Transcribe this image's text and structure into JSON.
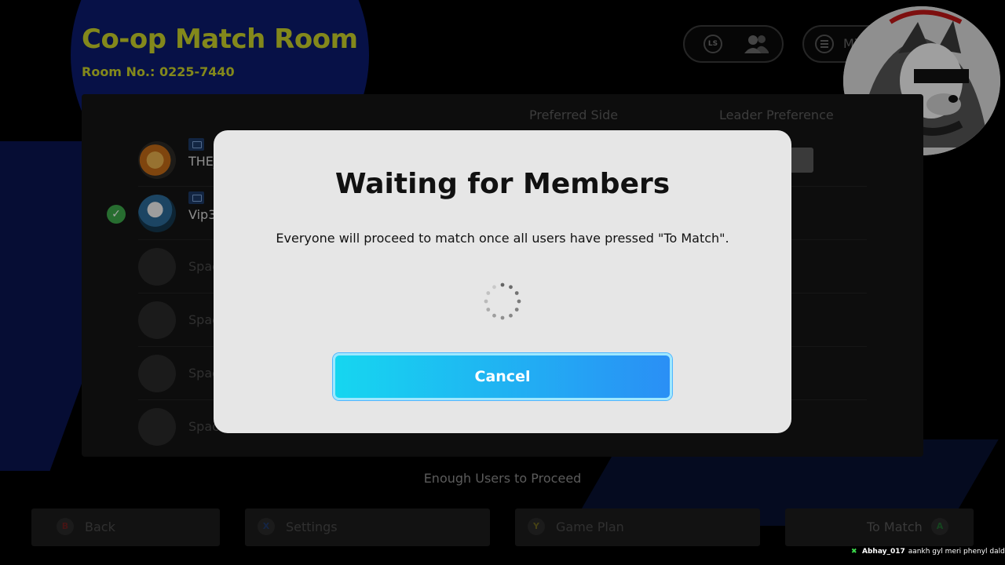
{
  "header": {
    "title": "Co-op Match Room",
    "room_no": "Room No.: 0225-7440",
    "ls_badge": "LS",
    "mission_label": "Mission"
  },
  "columns": {
    "preferred_side": "Preferred Side",
    "leader_preference": "Leader Preference"
  },
  "members": [
    {
      "name": "THE_",
      "icon": "pc-icon"
    },
    {
      "name": "Vip3",
      "icon": "pc-icon",
      "ready": true
    }
  ],
  "spaces": [
    {
      "label": "Spac"
    },
    {
      "label": "Spac"
    },
    {
      "label": "Spac"
    },
    {
      "label": "Spac"
    }
  ],
  "status": "Enough Users to Proceed",
  "bottom_bar": {
    "back": {
      "label": "Back",
      "glyph": "B"
    },
    "settings": {
      "label": "Settings",
      "glyph": "X"
    },
    "game_plan": {
      "label": "Game Plan",
      "glyph": "Y"
    },
    "to_match": {
      "label": "To Match",
      "glyph": "A"
    }
  },
  "dialog": {
    "title": "Waiting for Members",
    "message": "Everyone will proceed to match once all users have pressed \"To Match\".",
    "cancel_label": "Cancel"
  },
  "chat": {
    "user": "Abhay_017",
    "message": "aankh gyl meri phenyl daldu"
  },
  "colors": {
    "title": "#c9d22a",
    "cancel_gradient_start": "#16d6f0",
    "cancel_gradient_end": "#2a8ff5",
    "ready_check": "#3da84a"
  }
}
